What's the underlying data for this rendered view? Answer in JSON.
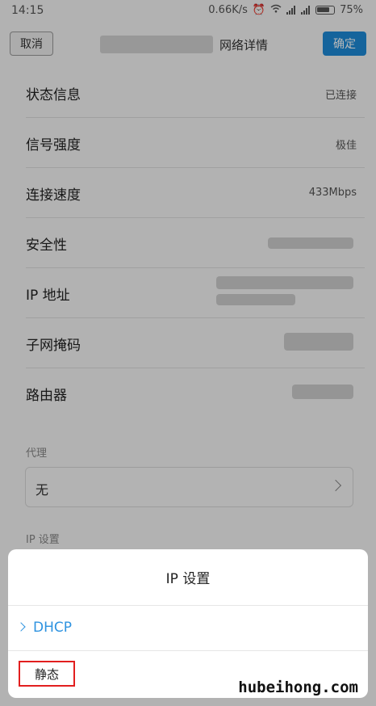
{
  "status_bar": {
    "time": "14:15",
    "speed": "0.66K/s",
    "battery": "75%"
  },
  "header": {
    "cancel_label": "取消",
    "title": "网络详情",
    "confirm_label": "确定"
  },
  "details": [
    {
      "label": "状态信息",
      "value": "已连接"
    },
    {
      "label": "信号强度",
      "value": "极佳"
    },
    {
      "label": "连接速度",
      "value": "433Mbps"
    },
    {
      "label": "安全性",
      "value": ""
    },
    {
      "label": "IP 地址",
      "value": ""
    },
    {
      "label": "子网掩码",
      "value": ""
    },
    {
      "label": "路由器",
      "value": ""
    }
  ],
  "proxy": {
    "section_label": "代理",
    "value": "无"
  },
  "ip_settings": {
    "section_label": "IP 设置"
  },
  "sheet": {
    "title": "IP  设置",
    "options": [
      {
        "label": "DHCP",
        "selected": true
      },
      {
        "label": "静态",
        "selected": false,
        "highlighted": true
      }
    ]
  },
  "colors": {
    "accent": "#2e93e0",
    "confirm_bg": "#1e8bd8",
    "highlight_border": "#e21f1f"
  },
  "watermark": "hubeihong.com"
}
